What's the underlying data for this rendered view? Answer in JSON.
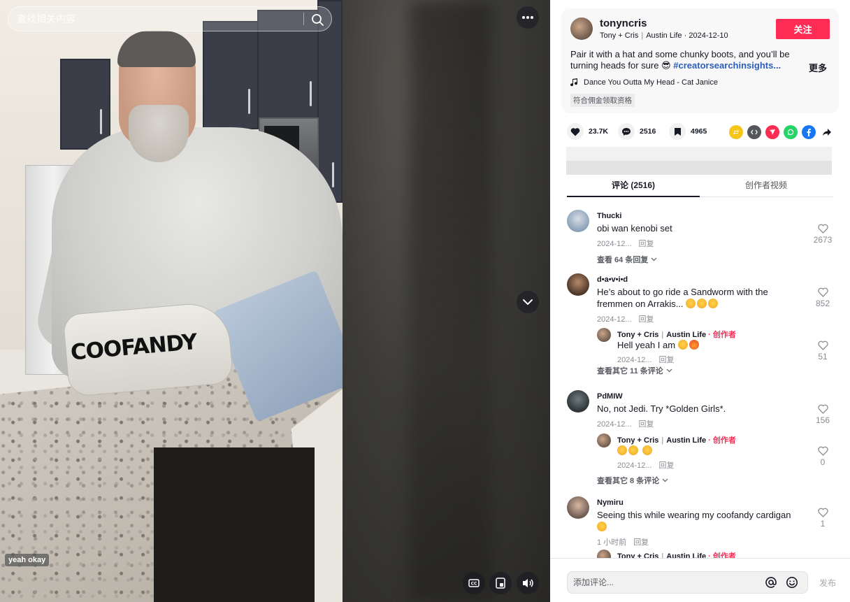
{
  "search": {
    "placeholder": "查找相关内容"
  },
  "video": {
    "caption_badge": "yeah okay",
    "bag_brand": "COOFANDY"
  },
  "author": {
    "username": "tonyncris",
    "display_name": "Tony + Cris",
    "location": "Austin Life",
    "date": "2024-12-10",
    "follow_label": "关注"
  },
  "description": {
    "text": "Pair it with a hat and some chunky boots, and you’ll be turning heads for sure 😎",
    "hashtag": "#creatorsearchinsights...",
    "more_label": "更多"
  },
  "music": "Dance You Outta My Head - Cat Janice",
  "commission_badge": "符合佣金领取资格",
  "stats": {
    "likes": "23.7K",
    "comments": "2516",
    "saves": "4965"
  },
  "tabs": [
    {
      "label": "评论 (2516)"
    },
    {
      "label": "创作者视频"
    }
  ],
  "comments": [
    {
      "user": "Thucki",
      "text": "obi wan kenobi set",
      "date": "2024-12...",
      "reply": "回复",
      "likes": "2673",
      "view_replies": "查看 64 条回复"
    },
    {
      "user": "d•a•v•i•d",
      "text": "He’s about to go ride a Sandworm with the fremmen on Arrakis...",
      "date": "2024-12...",
      "reply": "回复",
      "likes": "852",
      "sub": {
        "user": "Tony + Cris",
        "loc": "Austin Life",
        "creator": "· 创作者",
        "text": "Hell yeah I am",
        "date": "2024-12...",
        "reply": "回复",
        "likes": "51"
      },
      "view_replies": "查看其它 11 条评论"
    },
    {
      "user": "PdMIW",
      "text": "No, not Jedi. Try *Golden Girls*.",
      "date": "2024-12...",
      "reply": "回复",
      "likes": "156",
      "sub": {
        "user": "Tony + Cris",
        "loc": "Austin Life",
        "creator": "· 创作者",
        "text": "",
        "date": "2024-12...",
        "reply": "回复",
        "likes": "0"
      },
      "view_replies": "查看其它 8 条评论"
    },
    {
      "user": "Nymiru",
      "text": "Seeing this while wearing my coofandy cardigan",
      "date": "1 小时前",
      "reply": "回复",
      "likes": "1",
      "sub": {
        "user": "Tony + Cris",
        "loc": "Austin Life",
        "creator": "· 创作者"
      }
    }
  ],
  "composer": {
    "placeholder": "添加评论...",
    "post_label": "发布"
  }
}
